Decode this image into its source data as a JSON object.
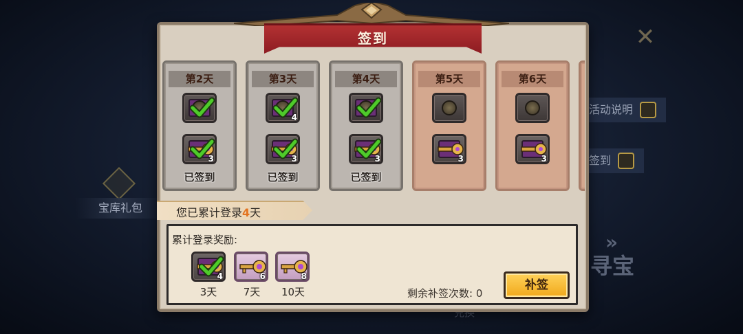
{
  "background": {
    "close_icon": "close-icon",
    "side_buttons": [
      {
        "label": "活动说明",
        "icon": "book-icon"
      },
      {
        "label": "签到",
        "icon": "calendar-icon"
      }
    ],
    "treasure_label": "宝库礼包",
    "big_text": "寻宝",
    "bottom_text": "兑换"
  },
  "dialog": {
    "title": "签到",
    "days": [
      {
        "label": "第2天",
        "status": "已签到",
        "state": "signed",
        "rewards": [
          {
            "icon": "coin-chest-icon",
            "qty": ""
          },
          {
            "icon": "key-chest-icon",
            "qty": "3"
          }
        ]
      },
      {
        "label": "第3天",
        "status": "已签到",
        "state": "signed",
        "rewards": [
          {
            "icon": "coin-chest-icon",
            "qty": "4"
          },
          {
            "icon": "key-chest-icon",
            "qty": "3"
          }
        ]
      },
      {
        "label": "第4天",
        "status": "已签到",
        "state": "signed",
        "rewards": [
          {
            "icon": "coin-chest-icon",
            "qty": ""
          },
          {
            "icon": "key-chest-icon",
            "qty": "3"
          }
        ]
      },
      {
        "label": "第5天",
        "status": "",
        "state": "pending",
        "rewards": [
          {
            "icon": "coin-chest-icon",
            "qty": ""
          },
          {
            "icon": "key-chest-icon",
            "qty": "3"
          }
        ]
      },
      {
        "label": "第6天",
        "status": "",
        "state": "pending",
        "rewards": [
          {
            "icon": "coin-chest-icon",
            "qty": ""
          },
          {
            "icon": "key-chest-icon",
            "qty": "3"
          }
        ]
      }
    ],
    "cumulative": {
      "prefix": "您已累计登录",
      "count": "4",
      "suffix": "天"
    },
    "rewards_title": "累计登录奖励:",
    "cumulative_rewards": [
      {
        "label": "3天",
        "qty": "4",
        "claimed": true
      },
      {
        "label": "7天",
        "qty": "6",
        "claimed": false
      },
      {
        "label": "10天",
        "qty": "8",
        "claimed": false
      }
    ],
    "remaining_label": "剩余补签次数:",
    "remaining_count": "0",
    "makeup_button": "补签"
  },
  "colors": {
    "accent_orange": "#e3731e",
    "ribbon_red": "#a32a2d",
    "button_gold": "#f7bd35",
    "check_green": "#4ecb2a"
  }
}
